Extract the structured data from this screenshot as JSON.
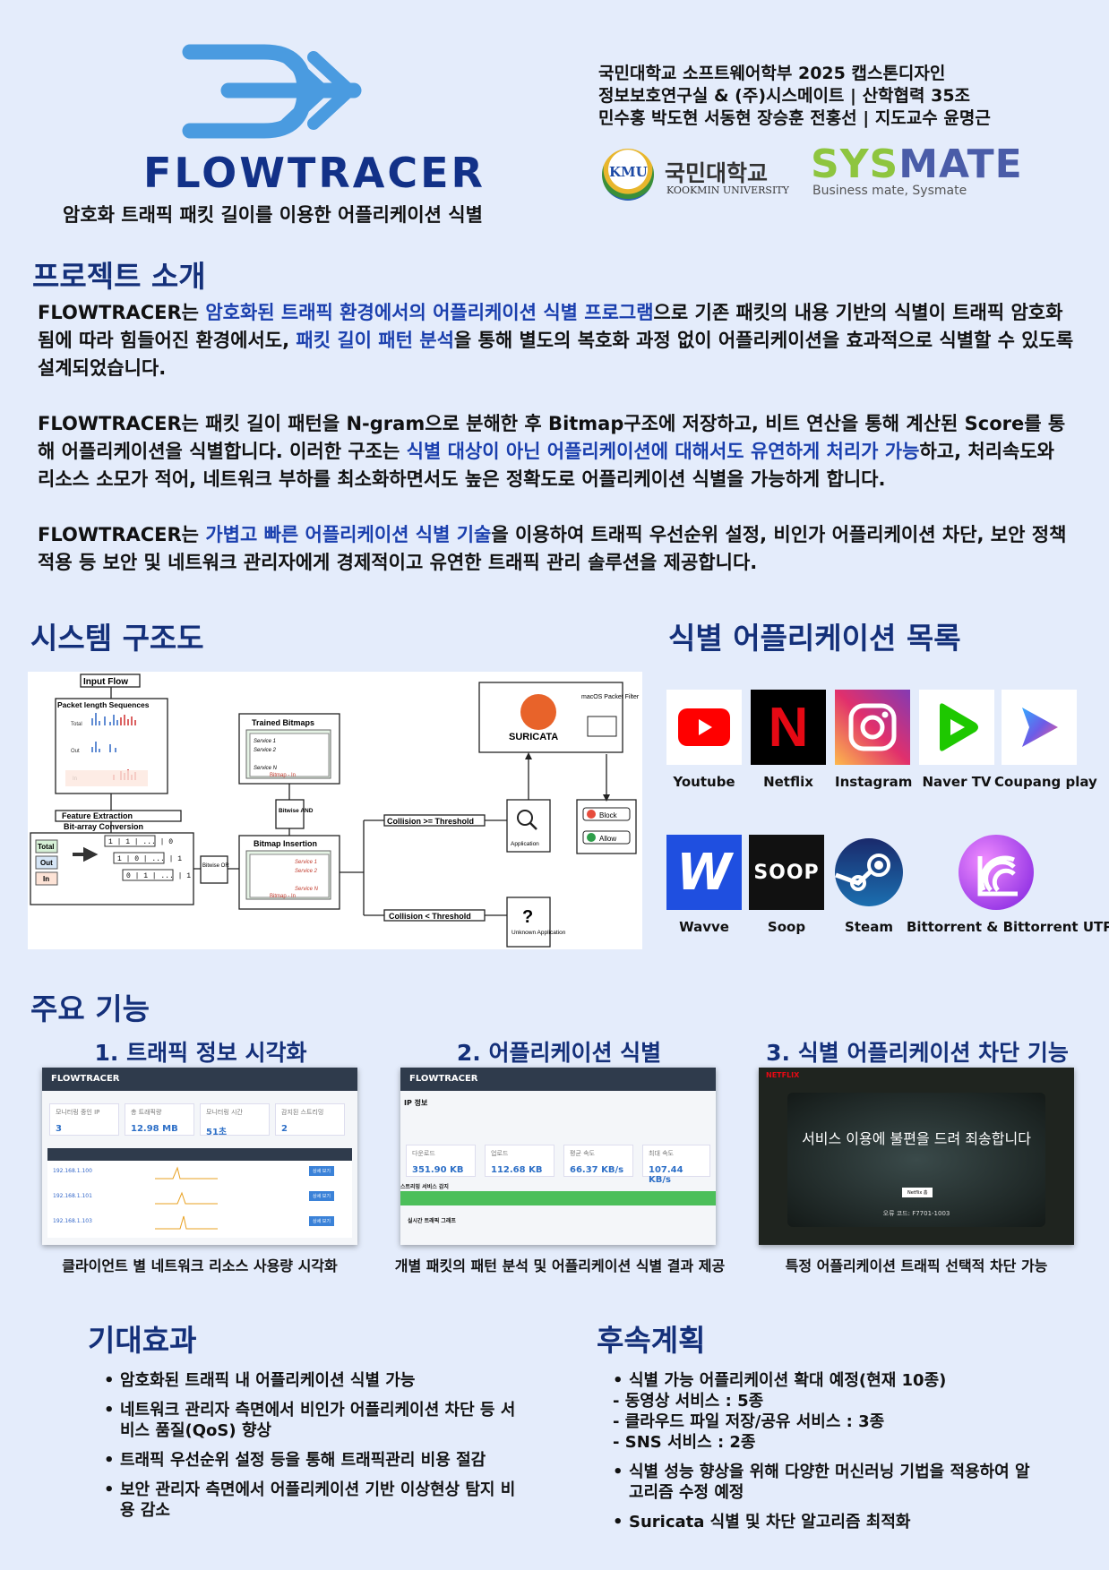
{
  "header": {
    "brand": "FLOWTRACER",
    "tagline": "암호화 트래픽 패킷 길이를 이용한 어플리케이션 식별",
    "info_lines": [
      "국민대학교 소프트웨어학부 2025 캡스톤디자인",
      "정보보호연구실 & (주)시스메이트 | 산학협력 35조",
      "민수홍 박도현 서동현 장승훈 전홍선 | 지도교수 윤명근"
    ],
    "kmu_badge": "KMU",
    "kmu_name": "국민대학교",
    "kmu_en": "KOOKMIN UNIVERSITY",
    "sysmate_a": "SYS",
    "sysmate_b": "MATE",
    "sysmate_sub": "Business mate, Sysmate"
  },
  "intro": {
    "title": "프로젝트 소개",
    "p1": [
      "FLOWTRACER는 ",
      "암호화된 트래픽 환경에서의 어플리케이션 식별 프로그램",
      "으로 기존 패킷의 내용 기반의 식별이 트래픽 암호화됨에 따라 힘들어진 환경에서도, ",
      "패킷 길이 패턴 분석",
      "을 통해 별도의 복호화 과정 없이 어플리케이션을 효과적으로 식별할 수 있도록 설계되었습니다."
    ],
    "p2": [
      "FLOWTRACER는 패킷 길이 패턴을 N-gram으로 분해한 후 Bitmap구조에 저장하고, 비트 연산을 통해 계산된 Score를 통해 어플리케이션을 식별합니다. 이러한 구조는 ",
      "식별 대상이 아닌 어플리케이션에 대해서도 유연하게 처리가 가능",
      "하고, 처리속도와 리소스 소모가 적어, 네트워크 부하를 최소화하면서도 높은 정확도로 어플리케이션 식별을 가능하게 합니다."
    ],
    "p3": [
      "FLOWTRACER는 ",
      "가볍고 빠른 어플리케이션 식별 기술",
      "을 이용하여 트래픽 우선순위 설정, 비인가 어플리케이션 차단, 보안 정책 적용 등 보안 및 네트워크 관리자에게 경제적이고 유연한 트래픽 관리 솔루션을 제공합니다."
    ]
  },
  "system": {
    "title": "시스템 구조도",
    "input_flow": "Input Flow",
    "pls": "Packet length Sequences",
    "total": "Total",
    "out": "Out",
    "in": "In",
    "feature_extraction": "Feature Extraction",
    "bit_array": "Bit-array Conversion",
    "bits1": "1 | 1 | ... | 0",
    "bits2": "1 | 0 | ... | 1",
    "bits3": "0 | 1 | ... | 1",
    "bitwise_or": "Bitwise OR",
    "trained": "Trained Bitmaps",
    "service1": "Service 1",
    "service2": "Service 2",
    "servicen": "Service N",
    "bitmap_in": "Bitmap - In",
    "bitwise_and": "Bitwise AND",
    "bitmap_insertion": "Bitmap Insertion",
    "collision_ge": "Collision >= Threshold",
    "collision_lt": "Collision < Threshold",
    "suricata": "SURICATA",
    "macos": "macOS Packet Filter",
    "application": "Application",
    "unknown": "Unknown Application",
    "block": "Block",
    "allow": "Allow"
  },
  "apps": {
    "title": "식별 어플리케이션 목록",
    "items": [
      "Youtube",
      "Netflix",
      "Instagram",
      "Naver TV",
      "Coupang play",
      "Wavve",
      "Soop",
      "Steam",
      "Bittorrent & Bittorrent UTP"
    ],
    "soop_logo": "SOOP",
    "wavve_logo": "W",
    "netflix_logo": "N"
  },
  "features": {
    "title": "주요 기능",
    "f1_title": "1. 트래픽 정보 시각화",
    "f2_title": "2. 어플리케이션 식별",
    "f3_title": "3. 식별 어플리케이션 차단 기능",
    "f1_cap": "클라이언트 별 네트워크 리소스 사용량 시각화",
    "f2_cap": "개별 패킷의 패턴 분석 및 어플리케이션 식별 결과 제공",
    "f3_cap": "특정 어플리케이션 트래픽 선택적 차단 가능",
    "s1_bar": "FLOWTRACER",
    "s1_cards": [
      [
        "모니터링 중인 IP",
        "3"
      ],
      [
        "총 트래픽량",
        "12.98 MB"
      ],
      [
        "모니터링 시간",
        "51초"
      ],
      [
        "감지된 스트리밍",
        "2"
      ]
    ],
    "s1_rows": [
      "192.168.1.100",
      "192.168.1.101",
      "192.168.1.103"
    ],
    "s1_btn": "상세 보기",
    "s2_bar": "FLOWTRACER",
    "s2_ip": "IP 정보",
    "s2_cards": [
      [
        "다운로드",
        "351.90 KB"
      ],
      [
        "업로드",
        "112.68 KB"
      ],
      [
        "평균 속도",
        "66.37 KB/s"
      ],
      [
        "최대 속도",
        "107.44 KB/s"
      ]
    ],
    "s2_detected": "스트리밍 서비스 감지",
    "s2_graph": "실시간 트래픽 그래프",
    "s3_brand": "NETFLIX",
    "s3_msg": "서비스 이용에 불편을 드려 죄송합니다",
    "s3_btn": "Netflix 홈",
    "s3_code": "오류 코드: F7701-1003"
  },
  "effects": {
    "title": "기대효과",
    "items": [
      "암호화된 트래픽 내 어플리케이션 식별 가능",
      "네트워크 관리자 측면에서 비인가 어플리케이션 차단 등 서비스 품질(QoS) 향상",
      "트래픽 우선순위 설정 등을 통해 트래픽관리 비용 절감",
      "보안 관리자 측면에서 어플리케이션 기반 이상현상 탐지 비용 감소"
    ]
  },
  "plans": {
    "title": "후속계획",
    "item1": "식별 가능 어플리케이션 확대 예정(현재 10종)",
    "sub": [
      "- 동영상 서비스 : 5종",
      "- 클라우드 파일 저장/공유 서비스 : 3종",
      "- SNS 서비스 : 2종"
    ],
    "item2": "식별 성능 향상을 위해 다양한 머신러닝 기법을 적용하여 알고리즘 수정 예정",
    "item3": "Suricata 식별 및 차단 알고리즘 최적화"
  }
}
